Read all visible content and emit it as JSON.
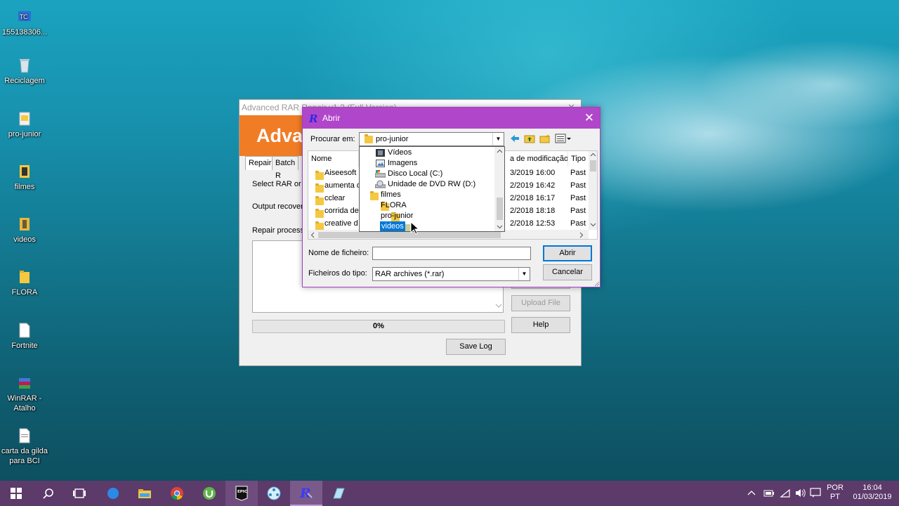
{
  "desktop": {
    "icons": [
      {
        "label": "155138306..."
      },
      {
        "label": "Reciclagem"
      },
      {
        "label": "pro-junior"
      },
      {
        "label": "filmes"
      },
      {
        "label": "videos"
      },
      {
        "label": "FLORA"
      },
      {
        "label": "Fortnite"
      },
      {
        "label": "WinRAR - Atalho"
      },
      {
        "label": "carta da gilda para BCI"
      }
    ]
  },
  "rar_window": {
    "title": "Advanced RAR Repair v1.2 (Full Version)",
    "close_glyph": "✕",
    "banner_text": "Advan",
    "tabs": [
      {
        "label": "Repair"
      },
      {
        "label": "Batch R"
      }
    ],
    "select_label": "Select RAR or S",
    "output_label": "Output recovere",
    "process_label": "Repair process l",
    "progress_text": "0%",
    "upload_label": "Upload File",
    "help_label": "Help",
    "save_log_label": "Save Log"
  },
  "dialog": {
    "title": "Abrir",
    "close_glyph": "✕",
    "look_in_label": "Procurar em:",
    "look_in_value": "pro-junior",
    "columns": {
      "name": "Nome",
      "date": "a de modificação...",
      "type": "Tipo"
    },
    "files": [
      {
        "name": "Aiseesoft",
        "date": "3/2019 16:00",
        "type": "Past"
      },
      {
        "name": "aumenta d",
        "date": "2/2019 16:42",
        "type": "Past"
      },
      {
        "name": "cclear",
        "date": "2/2018 16:17",
        "type": "Past"
      },
      {
        "name": "corrida de",
        "date": "2/2018 18:18",
        "type": "Past"
      },
      {
        "name": "creative d",
        "date": "2/2018 12:53",
        "type": "Past"
      }
    ],
    "dropdown_items": [
      {
        "label": "Vídeos",
        "icon": "film-icon"
      },
      {
        "label": "Imagens",
        "icon": "image-icon"
      },
      {
        "label": "Disco Local (C:)",
        "icon": "drive-icon"
      },
      {
        "label": "Unidade de DVD RW (D:)",
        "icon": "dvd-icon"
      },
      {
        "label": "filmes",
        "icon": "folder-icon"
      },
      {
        "label": "FLORA",
        "icon": "folder-icon"
      },
      {
        "label": "pro-junior",
        "icon": "folder-icon"
      },
      {
        "label": "videos",
        "icon": "folder-icon"
      }
    ],
    "filename_label": "Nome de ficheiro:",
    "filename_value": "",
    "filetype_label": "Ficheiros do tipo:",
    "filetype_value": "RAR archives (*.rar)",
    "open_label": "Abrir",
    "cancel_label": "Cancelar"
  },
  "taskbar": {
    "lang_top": "POR",
    "lang_bottom": "PT",
    "time": "16:04",
    "date": "01/03/2019"
  },
  "colors": {
    "dialog_accent": "#b046c9",
    "taskbar": "#5c3a6a",
    "banner": "#f07c26",
    "selection": "#0078d7"
  }
}
